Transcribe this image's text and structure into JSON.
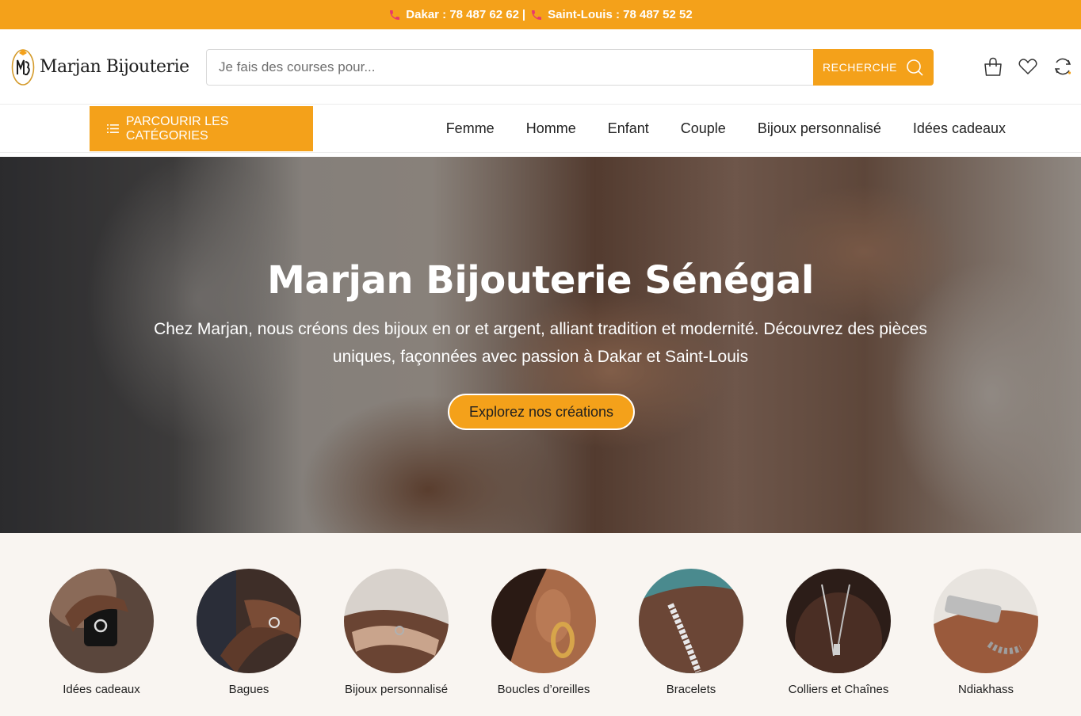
{
  "topbar": {
    "dakar": "Dakar : 78 487 62 62",
    "separator": "|",
    "saint_louis": "Saint-Louis : 78 487 52 52"
  },
  "header": {
    "logo_text": "Marjan Bijouterie",
    "search_placeholder": "Je fais des courses pour...",
    "search_button": "RECHERCHE",
    "icons": [
      "shopping-bag-icon",
      "heart-icon",
      "refresh-icon"
    ]
  },
  "nav": {
    "categories_button": "PARCOURIR LES CATÉGORIES",
    "links": [
      "Femme",
      "Homme",
      "Enfant",
      "Couple",
      "Bijoux personnalisé",
      "Idées cadeaux"
    ]
  },
  "hero": {
    "title": "Marjan Bijouterie Sénégal",
    "text": "Chez Marjan, nous créons des bijoux en or et argent, alliant tradition et modernité. Découvrez des pièces uniques, façonnées avec passion à Dakar et Saint-Louis",
    "button": "Explorez nos créations"
  },
  "categories": [
    {
      "label": "Idées cadeaux"
    },
    {
      "label": "Bagues"
    },
    {
      "label": "Bijoux personnalisé"
    },
    {
      "label": "Boucles d’oreilles"
    },
    {
      "label": "Bracelets"
    },
    {
      "label": "Colliers et Chaînes"
    },
    {
      "label": "Ndiakhass"
    }
  ],
  "colors": {
    "accent": "#f4a11a",
    "phone_icon": "#e8386d",
    "category_background": "#f9f5f1"
  }
}
